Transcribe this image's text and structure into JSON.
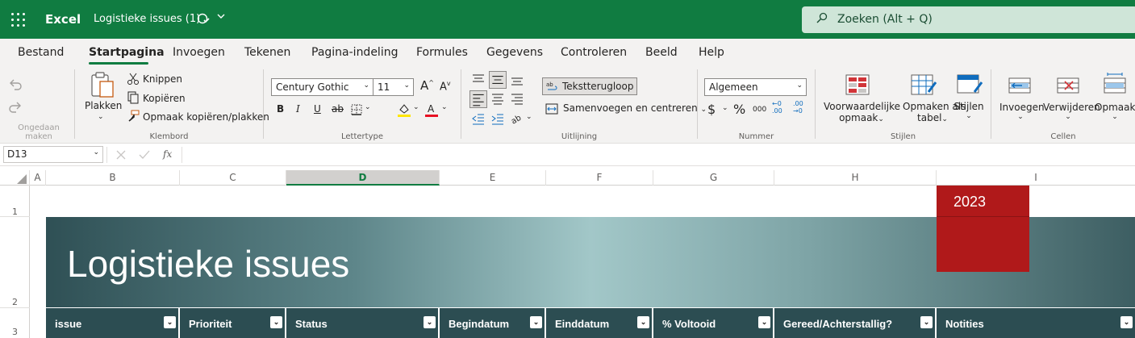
{
  "app": {
    "name": "Excel",
    "doc_title": "Logistieke issues (1)"
  },
  "search": {
    "placeholder": "Zoeken (Alt + Q)"
  },
  "tabs": [
    "Bestand",
    "Startpagina",
    "Invoegen",
    "Tekenen",
    "Pagina-indeling",
    "Formules",
    "Gegevens",
    "Controleren",
    "Beeld",
    "Help"
  ],
  "active_tab": "Startpagina",
  "ribbon": {
    "undo_group": "Ongedaan maken",
    "clipboard": {
      "label": "Klembord",
      "paste": "Plakken",
      "cut": "Knippen",
      "copy": "Kopiëren",
      "format_painter": "Opmaak kopiëren/plakken"
    },
    "font": {
      "label": "Lettertype",
      "family": "Century Gothic",
      "size": "11"
    },
    "alignment": {
      "label": "Uitlijning",
      "wrap": "Tekstterugloop",
      "merge": "Samenvoegen en centreren"
    },
    "number": {
      "label": "Nummer",
      "format": "Algemeen"
    },
    "styles": {
      "label": "Stijlen",
      "conditional_1": "Voorwaardelijke",
      "conditional_2": "opmaak",
      "table_1": "Opmaken als",
      "table_2": "tabel",
      "cell_styles": "Stijlen"
    },
    "cells": {
      "label": "Cellen",
      "insert": "Invoegen",
      "delete": "Verwijderen",
      "format": "Opmaak"
    }
  },
  "formula_bar": {
    "name_box": "D13",
    "formula": ""
  },
  "columns": [
    "A",
    "B",
    "C",
    "D",
    "E",
    "F",
    "G",
    "H",
    "I"
  ],
  "selected_column": "D",
  "rows": [
    "1",
    "2",
    "3"
  ],
  "sheet": {
    "year": "2023",
    "title": "Logistieke issues",
    "headers": [
      "issue",
      "Prioriteit",
      "Status",
      "Begindatum",
      "Einddatum",
      "% Voltooid",
      "Gereed/Achterstallig?",
      "Notities"
    ]
  },
  "colors": {
    "excel_green": "#107c41",
    "banner_dark": "#2f5055",
    "banner_light": "#a2c7c8",
    "year_red": "#b0191a",
    "header_bg": "#2c4d52"
  }
}
